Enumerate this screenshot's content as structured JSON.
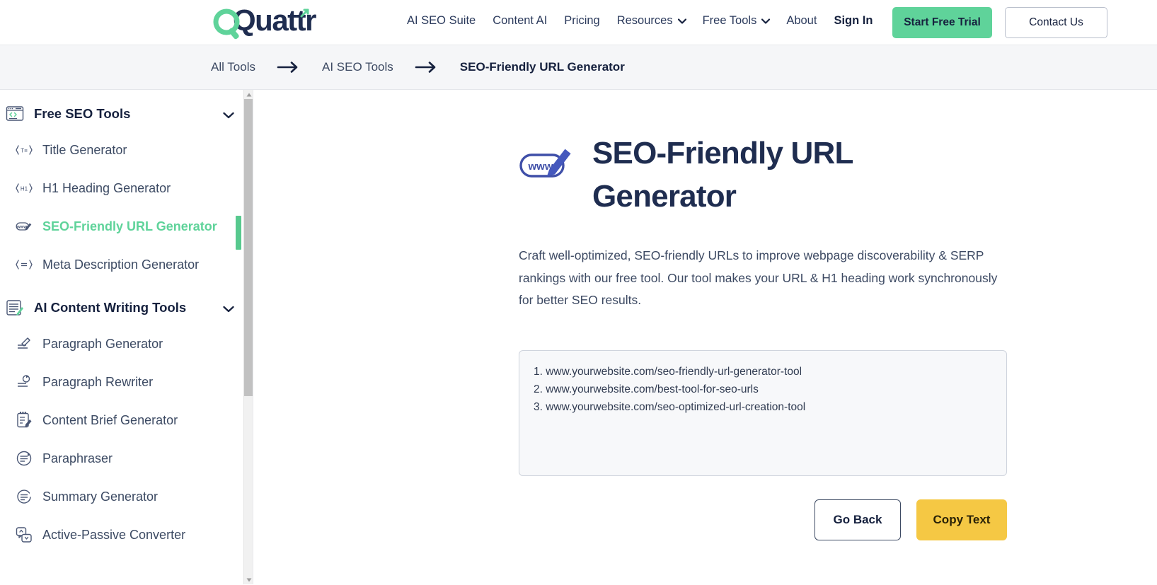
{
  "brand": {
    "logo_text": "Quattr",
    "accent_green": "#5fd39a",
    "dark_navy": "#1f2d50",
    "yellow": "#f5c844"
  },
  "nav": {
    "links": [
      {
        "label": "AI SEO Suite",
        "has_caret": false,
        "bold": false
      },
      {
        "label": "Content AI",
        "has_caret": false,
        "bold": false
      },
      {
        "label": "Pricing",
        "has_caret": false,
        "bold": false
      },
      {
        "label": "Resources",
        "has_caret": true,
        "bold": false
      },
      {
        "label": "Free Tools",
        "has_caret": true,
        "bold": false
      },
      {
        "label": "About",
        "has_caret": false,
        "bold": false
      },
      {
        "label": "Sign In",
        "has_caret": false,
        "bold": true
      }
    ],
    "cta_primary": "Start Free Trial",
    "cta_outline": "Contact Us"
  },
  "breadcrumb": {
    "items": [
      "All Tools",
      "AI SEO Tools",
      "SEO-Friendly URL Generator"
    ],
    "separator": "→"
  },
  "sidebar": {
    "groups": [
      {
        "title": "Free SEO Tools",
        "icon": "browser-code-icon",
        "caret": "chevron-down-icon",
        "items": [
          {
            "label": "Title Generator",
            "icon": "title-tag-icon",
            "active": false
          },
          {
            "label": "H1 Heading Generator",
            "icon": "h1-tag-icon",
            "active": false
          },
          {
            "label": "SEO-Friendly URL Generator",
            "icon": "url-pencil-icon",
            "active": true
          },
          {
            "label": "Meta Description Generator",
            "icon": "meta-tag-icon",
            "active": false
          }
        ]
      },
      {
        "title": "AI Content Writing Tools",
        "icon": "document-pencil-icon",
        "caret": "chevron-down-icon",
        "items": [
          {
            "label": "Paragraph Generator",
            "icon": "paragraph-pen-icon",
            "active": false
          },
          {
            "label": "Paragraph Rewriter",
            "icon": "paragraph-refresh-icon",
            "active": false
          },
          {
            "label": "Content Brief Generator",
            "icon": "clipboard-edit-icon",
            "active": false
          },
          {
            "label": "Paraphraser",
            "icon": "circle-lines-icon",
            "active": false
          },
          {
            "label": "Summary Generator",
            "icon": "summary-lines-icon",
            "active": false
          },
          {
            "label": "Active-Passive Converter",
            "icon": "chat-swap-icon",
            "active": false
          }
        ]
      }
    ]
  },
  "main": {
    "icon": "www-pencil-icon",
    "title": "SEO-Friendly URL Generator",
    "description": "Craft well-optimized, SEO-friendly URLs to improve webpage discoverability & SERP rankings with our free tool. Our tool makes your URL & H1 heading work synchronously for better SEO results.",
    "results": [
      "1. www.yourwebsite.com/seo-friendly-url-generator-tool",
      "2. www.yourwebsite.com/best-tool-for-seo-urls",
      "3. www.yourwebsite.com/seo-optimized-url-creation-tool"
    ],
    "go_back_label": "Go Back",
    "copy_text_label": "Copy Text"
  }
}
